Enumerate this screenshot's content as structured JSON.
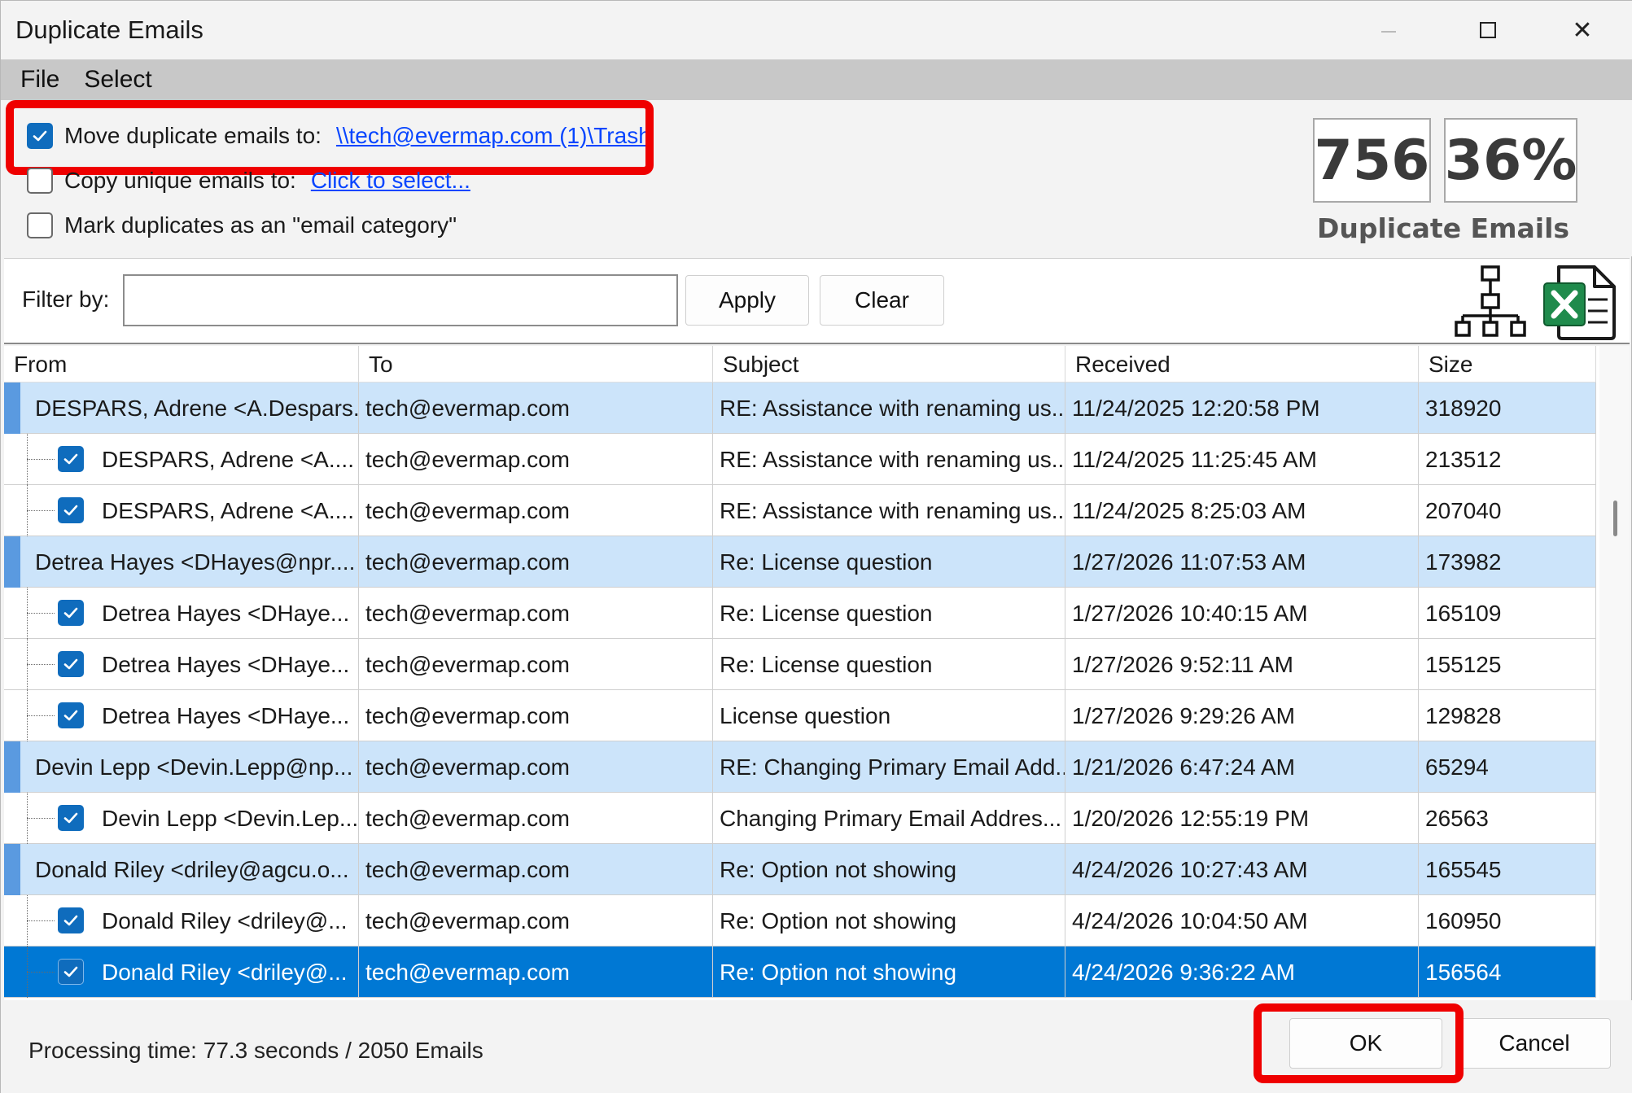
{
  "window": {
    "title": "Duplicate Emails"
  },
  "menu": [
    "File",
    "Select"
  ],
  "options": {
    "move": {
      "label": "Move duplicate emails to:",
      "link": "\\\\tech@evermap.com (1)\\Trash",
      "checked": true
    },
    "copy": {
      "label": "Copy unique emails to:",
      "link": "Click to select...",
      "checked": false
    },
    "mark": {
      "label": "Mark duplicates as an \"email category\"",
      "checked": false
    }
  },
  "stats": {
    "count": "756",
    "percent": "36%",
    "caption": "Duplicate Emails"
  },
  "filter": {
    "label": "Filter by:",
    "value": "",
    "apply_label": "Apply",
    "clear_label": "Clear"
  },
  "table": {
    "columns": [
      "From",
      "To",
      "Subject",
      "Received",
      "Size"
    ],
    "rows": [
      {
        "type": "group",
        "from": "DESPARS, Adrene <A.Despars...",
        "to": "tech@evermap.com",
        "subject": "RE: Assistance with renaming us...",
        "received": "11/24/2025 12:20:58 PM",
        "size": "318920"
      },
      {
        "type": "child",
        "from": "DESPARS, Adrene <A....",
        "to": "tech@evermap.com",
        "subject": "RE: Assistance with renaming us...",
        "received": "11/24/2025 11:25:45 AM",
        "size": "213512"
      },
      {
        "type": "child",
        "from": "DESPARS, Adrene <A....",
        "to": "tech@evermap.com",
        "subject": "RE: Assistance with renaming us...",
        "received": "11/24/2025 8:25:03 AM",
        "size": "207040"
      },
      {
        "type": "group",
        "from": "Detrea Hayes <DHayes@npr....",
        "to": "tech@evermap.com",
        "subject": "Re: License question",
        "received": "1/27/2026 11:07:53 AM",
        "size": "173982"
      },
      {
        "type": "child",
        "from": "Detrea Hayes <DHaye...",
        "to": "tech@evermap.com",
        "subject": "Re: License question",
        "received": "1/27/2026 10:40:15 AM",
        "size": "165109"
      },
      {
        "type": "child",
        "from": "Detrea Hayes <DHaye...",
        "to": "tech@evermap.com",
        "subject": "Re: License question",
        "received": "1/27/2026 9:52:11 AM",
        "size": "155125"
      },
      {
        "type": "child",
        "from": "Detrea Hayes <DHaye...",
        "to": "tech@evermap.com",
        "subject": "License question",
        "received": "1/27/2026 9:29:26 AM",
        "size": "129828"
      },
      {
        "type": "group",
        "from": "Devin Lepp <Devin.Lepp@np...",
        "to": "tech@evermap.com",
        "subject": "RE: Changing Primary Email Add...",
        "received": "1/21/2026 6:47:24 AM",
        "size": "65294"
      },
      {
        "type": "child",
        "from": "Devin Lepp <Devin.Lep...",
        "to": "tech@evermap.com",
        "subject": "Changing Primary Email Addres...",
        "received": "1/20/2026 12:55:19 PM",
        "size": "26563"
      },
      {
        "type": "group",
        "from": "Donald Riley <driley@agcu.o...",
        "to": "tech@evermap.com",
        "subject": "Re: Option not showing",
        "received": "4/24/2026 10:27:43 AM",
        "size": "165545"
      },
      {
        "type": "child",
        "from": "Donald Riley <driley@...",
        "to": "tech@evermap.com",
        "subject": "Re: Option not showing",
        "received": "4/24/2026 10:04:50 AM",
        "size": "160950"
      },
      {
        "type": "child",
        "selected": true,
        "from": "Donald Riley <driley@...",
        "to": "tech@evermap.com",
        "subject": "Re: Option not showing",
        "received": "4/24/2026 9:36:22 AM",
        "size": "156564"
      }
    ]
  },
  "footer": {
    "status": "Processing time: 77.3 seconds / 2050 Emails",
    "ok_label": "OK",
    "cancel_label": "Cancel"
  },
  "colors": {
    "highlight": "#ef0000",
    "selection": "#0078d4",
    "group_row": "#cce4fa",
    "link": "#0645ff"
  },
  "icons": [
    "maximize-icon",
    "close-icon",
    "tree-hierarchy-icon",
    "excel-export-icon",
    "checkmark-icon"
  ]
}
